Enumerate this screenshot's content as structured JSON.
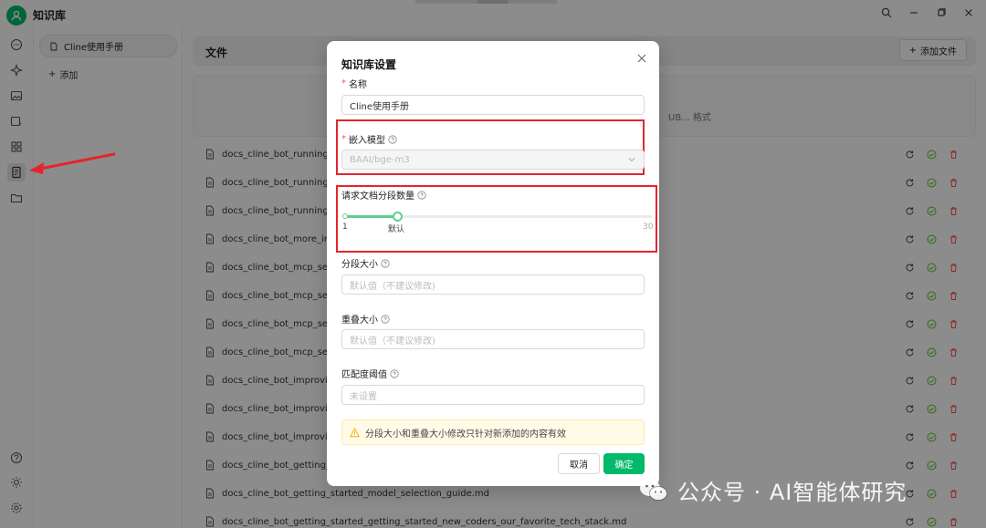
{
  "app": {
    "title": "知识库"
  },
  "knowledge_bases": {
    "items": [
      {
        "label": "Cline使用手册"
      }
    ],
    "add_label": "添加"
  },
  "files": {
    "title": "文件",
    "add_button": "添加文件",
    "drop_hint": "UB... 格式",
    "rows": [
      "docs_cline_bot_running_m",
      "docs_cline_bot_running_m",
      "docs_cline_bot_running_m",
      "docs_cline_bot_more_info_",
      "docs_cline_bot_mcp_server",
      "docs_cline_bot_mcp_server",
      "docs_cline_bot_mcp_server",
      "docs_cline_bot_mcp_server",
      "docs_cline_bot_improving_",
      "docs_cline_bot_improving_",
      "docs_cline_bot_improving_",
      "docs_cline_bot_getting_star",
      "docs_cline_bot_getting_started_model_selection_guide.md",
      "docs_cline_bot_getting_started_getting_started_new_coders_our_favorite_tech_stack.md"
    ]
  },
  "dialog": {
    "title": "知识库设置",
    "name_label": "名称",
    "name_value": "Cline使用手册",
    "embed_label": "嵌入模型",
    "embed_value": "BAAI/bge-m3",
    "chunks_label": "请求文档分段数量",
    "slider": {
      "min": "1",
      "max": "30",
      "default_label": "默认",
      "value": 6
    },
    "chunk_size_label": "分段大小",
    "chunk_size_placeholder": "默认值（不建议修改)",
    "overlap_label": "重叠大小",
    "overlap_placeholder": "默认值（不建议修改)",
    "threshold_label": "匹配度阈值",
    "threshold_placeholder": "未设置",
    "alert": "分段大小和重叠大小修改只针对新添加的内容有效",
    "cancel": "取消",
    "ok": "确定"
  },
  "watermark": {
    "text": "公众号 · AI智能体研究"
  },
  "colors": {
    "accent": "#00b96b",
    "highlight": "#e4252d",
    "danger": "#ff4d4f"
  }
}
